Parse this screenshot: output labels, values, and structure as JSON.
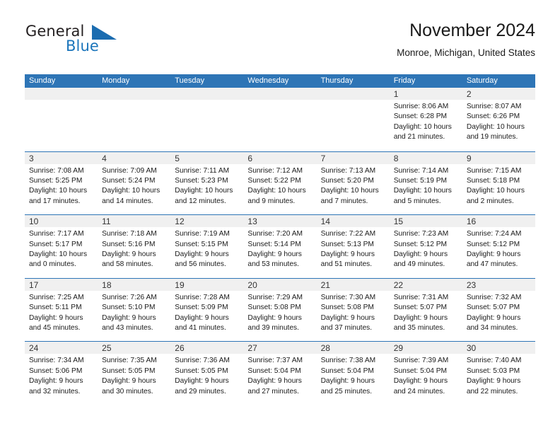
{
  "brand": {
    "name_part1": "General",
    "name_part2": "Blue",
    "flag_icon": "triangle-flag-icon",
    "accent_color": "#1b75bb"
  },
  "header": {
    "title": "November 2024",
    "location": "Monroe, Michigan, United States"
  },
  "calendar": {
    "header_bg": "#2e75b6",
    "day_band_bg": "#f0f0f0",
    "weekdays": [
      "Sunday",
      "Monday",
      "Tuesday",
      "Wednesday",
      "Thursday",
      "Friday",
      "Saturday"
    ],
    "weeks": [
      [
        {
          "date": "",
          "empty": true
        },
        {
          "date": "",
          "empty": true
        },
        {
          "date": "",
          "empty": true
        },
        {
          "date": "",
          "empty": true
        },
        {
          "date": "",
          "empty": true
        },
        {
          "date": "1",
          "sunrise": "Sunrise: 8:06 AM",
          "sunset": "Sunset: 6:28 PM",
          "daylight_line1": "Daylight: 10 hours",
          "daylight_line2": "and 21 minutes."
        },
        {
          "date": "2",
          "sunrise": "Sunrise: 8:07 AM",
          "sunset": "Sunset: 6:26 PM",
          "daylight_line1": "Daylight: 10 hours",
          "daylight_line2": "and 19 minutes."
        }
      ],
      [
        {
          "date": "3",
          "sunrise": "Sunrise: 7:08 AM",
          "sunset": "Sunset: 5:25 PM",
          "daylight_line1": "Daylight: 10 hours",
          "daylight_line2": "and 17 minutes."
        },
        {
          "date": "4",
          "sunrise": "Sunrise: 7:09 AM",
          "sunset": "Sunset: 5:24 PM",
          "daylight_line1": "Daylight: 10 hours",
          "daylight_line2": "and 14 minutes."
        },
        {
          "date": "5",
          "sunrise": "Sunrise: 7:11 AM",
          "sunset": "Sunset: 5:23 PM",
          "daylight_line1": "Daylight: 10 hours",
          "daylight_line2": "and 12 minutes."
        },
        {
          "date": "6",
          "sunrise": "Sunrise: 7:12 AM",
          "sunset": "Sunset: 5:22 PM",
          "daylight_line1": "Daylight: 10 hours",
          "daylight_line2": "and 9 minutes."
        },
        {
          "date": "7",
          "sunrise": "Sunrise: 7:13 AM",
          "sunset": "Sunset: 5:20 PM",
          "daylight_line1": "Daylight: 10 hours",
          "daylight_line2": "and 7 minutes."
        },
        {
          "date": "8",
          "sunrise": "Sunrise: 7:14 AM",
          "sunset": "Sunset: 5:19 PM",
          "daylight_line1": "Daylight: 10 hours",
          "daylight_line2": "and 5 minutes."
        },
        {
          "date": "9",
          "sunrise": "Sunrise: 7:15 AM",
          "sunset": "Sunset: 5:18 PM",
          "daylight_line1": "Daylight: 10 hours",
          "daylight_line2": "and 2 minutes."
        }
      ],
      [
        {
          "date": "10",
          "sunrise": "Sunrise: 7:17 AM",
          "sunset": "Sunset: 5:17 PM",
          "daylight_line1": "Daylight: 10 hours",
          "daylight_line2": "and 0 minutes."
        },
        {
          "date": "11",
          "sunrise": "Sunrise: 7:18 AM",
          "sunset": "Sunset: 5:16 PM",
          "daylight_line1": "Daylight: 9 hours",
          "daylight_line2": "and 58 minutes."
        },
        {
          "date": "12",
          "sunrise": "Sunrise: 7:19 AM",
          "sunset": "Sunset: 5:15 PM",
          "daylight_line1": "Daylight: 9 hours",
          "daylight_line2": "and 56 minutes."
        },
        {
          "date": "13",
          "sunrise": "Sunrise: 7:20 AM",
          "sunset": "Sunset: 5:14 PM",
          "daylight_line1": "Daylight: 9 hours",
          "daylight_line2": "and 53 minutes."
        },
        {
          "date": "14",
          "sunrise": "Sunrise: 7:22 AM",
          "sunset": "Sunset: 5:13 PM",
          "daylight_line1": "Daylight: 9 hours",
          "daylight_line2": "and 51 minutes."
        },
        {
          "date": "15",
          "sunrise": "Sunrise: 7:23 AM",
          "sunset": "Sunset: 5:12 PM",
          "daylight_line1": "Daylight: 9 hours",
          "daylight_line2": "and 49 minutes."
        },
        {
          "date": "16",
          "sunrise": "Sunrise: 7:24 AM",
          "sunset": "Sunset: 5:12 PM",
          "daylight_line1": "Daylight: 9 hours",
          "daylight_line2": "and 47 minutes."
        }
      ],
      [
        {
          "date": "17",
          "sunrise": "Sunrise: 7:25 AM",
          "sunset": "Sunset: 5:11 PM",
          "daylight_line1": "Daylight: 9 hours",
          "daylight_line2": "and 45 minutes."
        },
        {
          "date": "18",
          "sunrise": "Sunrise: 7:26 AM",
          "sunset": "Sunset: 5:10 PM",
          "daylight_line1": "Daylight: 9 hours",
          "daylight_line2": "and 43 minutes."
        },
        {
          "date": "19",
          "sunrise": "Sunrise: 7:28 AM",
          "sunset": "Sunset: 5:09 PM",
          "daylight_line1": "Daylight: 9 hours",
          "daylight_line2": "and 41 minutes."
        },
        {
          "date": "20",
          "sunrise": "Sunrise: 7:29 AM",
          "sunset": "Sunset: 5:08 PM",
          "daylight_line1": "Daylight: 9 hours",
          "daylight_line2": "and 39 minutes."
        },
        {
          "date": "21",
          "sunrise": "Sunrise: 7:30 AM",
          "sunset": "Sunset: 5:08 PM",
          "daylight_line1": "Daylight: 9 hours",
          "daylight_line2": "and 37 minutes."
        },
        {
          "date": "22",
          "sunrise": "Sunrise: 7:31 AM",
          "sunset": "Sunset: 5:07 PM",
          "daylight_line1": "Daylight: 9 hours",
          "daylight_line2": "and 35 minutes."
        },
        {
          "date": "23",
          "sunrise": "Sunrise: 7:32 AM",
          "sunset": "Sunset: 5:07 PM",
          "daylight_line1": "Daylight: 9 hours",
          "daylight_line2": "and 34 minutes."
        }
      ],
      [
        {
          "date": "24",
          "sunrise": "Sunrise: 7:34 AM",
          "sunset": "Sunset: 5:06 PM",
          "daylight_line1": "Daylight: 9 hours",
          "daylight_line2": "and 32 minutes."
        },
        {
          "date": "25",
          "sunrise": "Sunrise: 7:35 AM",
          "sunset": "Sunset: 5:05 PM",
          "daylight_line1": "Daylight: 9 hours",
          "daylight_line2": "and 30 minutes."
        },
        {
          "date": "26",
          "sunrise": "Sunrise: 7:36 AM",
          "sunset": "Sunset: 5:05 PM",
          "daylight_line1": "Daylight: 9 hours",
          "daylight_line2": "and 29 minutes."
        },
        {
          "date": "27",
          "sunrise": "Sunrise: 7:37 AM",
          "sunset": "Sunset: 5:04 PM",
          "daylight_line1": "Daylight: 9 hours",
          "daylight_line2": "and 27 minutes."
        },
        {
          "date": "28",
          "sunrise": "Sunrise: 7:38 AM",
          "sunset": "Sunset: 5:04 PM",
          "daylight_line1": "Daylight: 9 hours",
          "daylight_line2": "and 25 minutes."
        },
        {
          "date": "29",
          "sunrise": "Sunrise: 7:39 AM",
          "sunset": "Sunset: 5:04 PM",
          "daylight_line1": "Daylight: 9 hours",
          "daylight_line2": "and 24 minutes."
        },
        {
          "date": "30",
          "sunrise": "Sunrise: 7:40 AM",
          "sunset": "Sunset: 5:03 PM",
          "daylight_line1": "Daylight: 9 hours",
          "daylight_line2": "and 22 minutes."
        }
      ]
    ]
  }
}
